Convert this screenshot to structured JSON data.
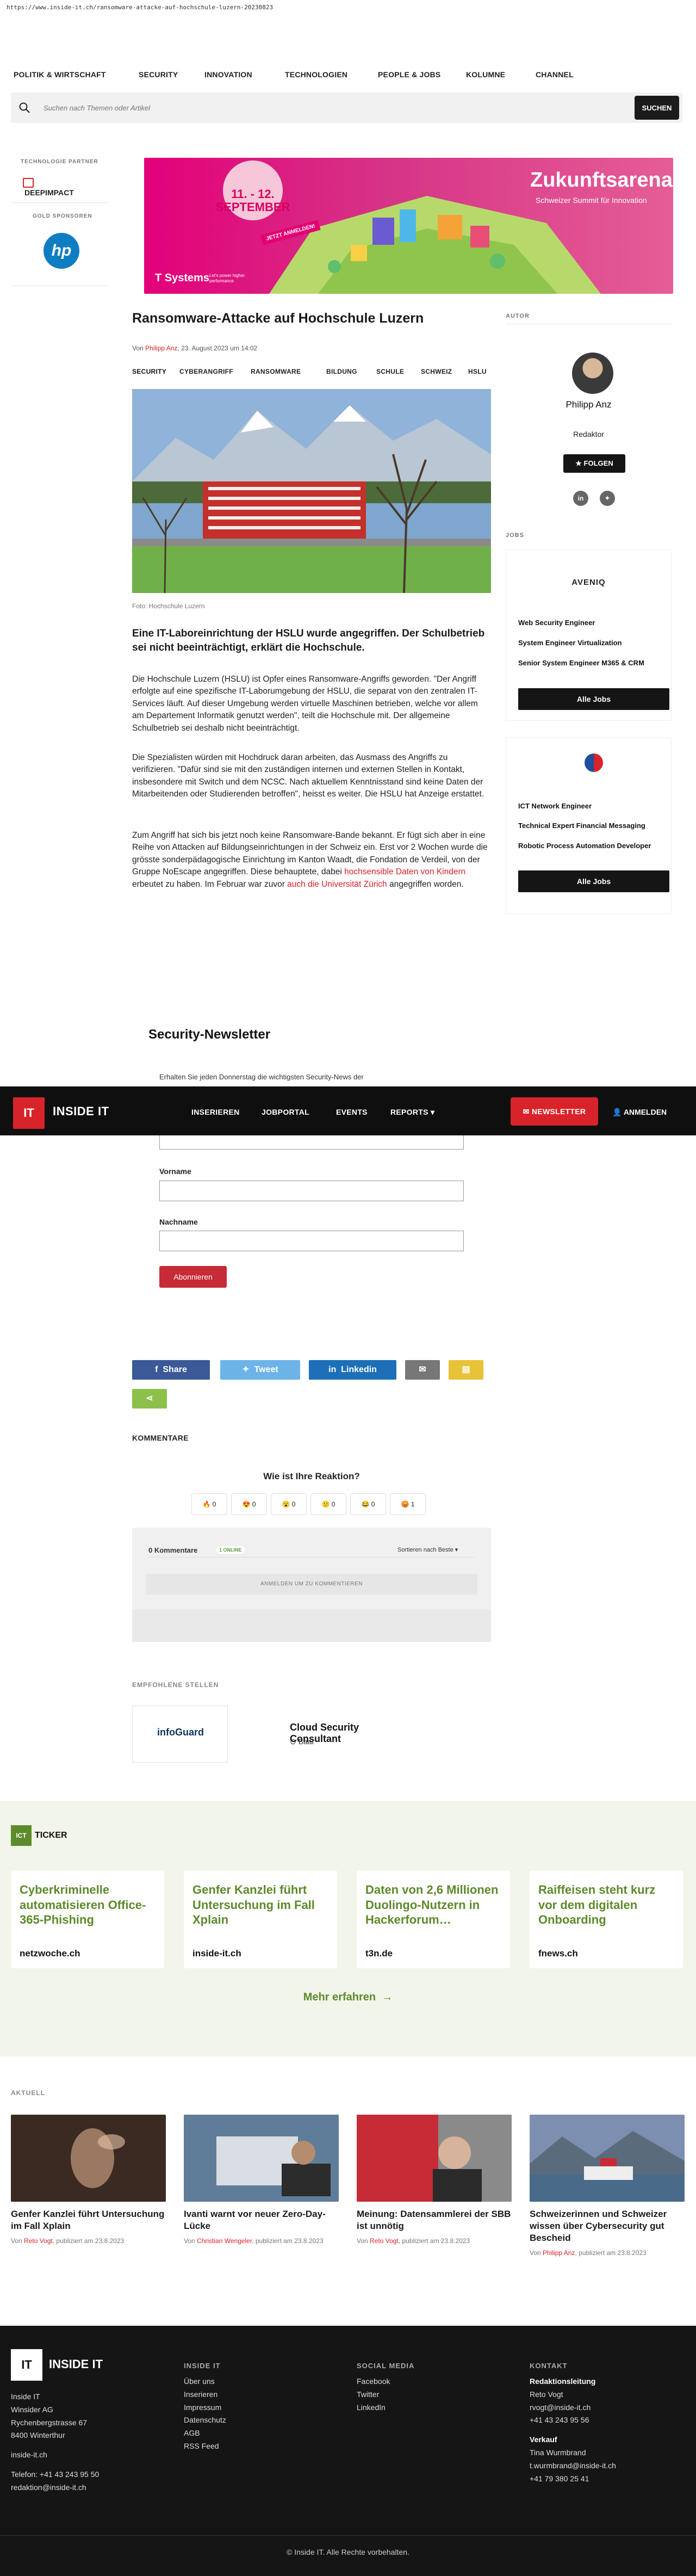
{
  "browser": {
    "url": "https://www.inside-it.ch/ransomware-attacke-auf-hochschule-luzern-20230823"
  },
  "top_nav": {
    "items": [
      "POLITIK & WIRTSCHAFT",
      "SECURITY",
      "INNOVATION",
      "TECHNOLOGIEN",
      "PEOPLE & JOBS",
      "KOLUMNE",
      "CHANNEL"
    ]
  },
  "search": {
    "placeholder": "Suchen nach Themen oder Artikel",
    "button": "SUCHEN"
  },
  "sidebar": {
    "partner_label": "TECHNOLOGIE PARTNER",
    "partner_name": "DEEPIMPACT",
    "gold_label": "GOLD SPONSOREN",
    "gold_name": "hp"
  },
  "banner": {
    "title": "Zukunftsarena",
    "subtitle": "Schweizer Summit für Innovation",
    "date": "11. - 12. SEPTEMBER",
    "cta": "JETZT ANMELDEN!",
    "sponsor": "T Systems",
    "sponsor_tag": "Let's power higher performance"
  },
  "article": {
    "title": "Ransomware-Attacke auf Hochschule Luzern",
    "by_prefix": "Von",
    "author": "Philipp Anz",
    "date": ", 23. August 2023 um 14:02",
    "tags": [
      "SECURITY",
      "CYBERANGRIFF",
      "RANSOMWARE",
      "BILDUNG",
      "SCHULE",
      "SCHWEIZ",
      "HSLU"
    ],
    "caption": "Foto: Hochschule Luzern",
    "lead": "Eine IT-Laboreinrichtung der HSLU wurde angegriffen. Der Schulbetrieb sei nicht beeinträchtigt, erklärt die Hochschule.",
    "p1": "Die Hochschule Luzern (HSLU) ist Opfer eines Ransomware-Angriffs geworden. \"Der Angriff erfolgte auf eine spezifische IT-Laborumgebung der HSLU, die separat von den zentralen IT-Services läuft. Auf dieser Umgebung werden virtuelle Maschinen betrieben, welche vor allem am Departement Informatik genutzt werden\", teilt die Hochschule mit. Der allgemeine Schulbetrieb sei deshalb nicht beeinträchtigt.",
    "p2": "Die Spezialisten würden mit Hochdruck daran arbeiten, das Ausmass des Angriffs zu verifizieren. \"Dafür sind sie mit den zuständigen internen und externen Stellen in Kontakt, insbesondere mit Switch und dem NCSC. Nach aktuellem Kenntnisstand sind keine Daten der Mitarbeitenden oder Studierenden betroffen\", heisst es weiter. Die HSLU hat Anzeige erstattet.",
    "p3_a": "Zum Angriff hat sich bis jetzt noch keine Ransomware-Bande bekannt. Er fügt sich aber in eine Reihe von Attacken auf Bildungseinrichtungen in der Schweiz ein. Erst vor 2 Wochen wurde die grösste sonderpädagogische Einrichtung im Kanton Waadt, die Fondation de Verdeil, von der Gruppe NoEscape angegriffen. Diese behauptete, dabei ",
    "p3_link1": "hochsensible Daten von Kindern",
    "p3_b": " erbeutet zu haben. Im Februar war zuvor ",
    "p3_link2": "auch die Universität Zürich",
    "p3_c": " angegriffen worden."
  },
  "author_box": {
    "label": "AUTOR",
    "name": "Philipp Anz",
    "role": "Redaktor",
    "follow": "FOLGEN"
  },
  "jobs": {
    "label": "JOBS",
    "company1": "AVENIQ",
    "list1": [
      "Web Security Engineer",
      "System Engineer Virtualization",
      "Senior System Engineer M365 & CRM"
    ],
    "list2": [
      "ICT Network Engineer",
      "Technical Expert Financial Messaging",
      "Robotic Process Automation Developer"
    ],
    "all_jobs": "Alle Jobs"
  },
  "newsletter": {
    "title": "Security-Newsletter",
    "text": "Erhalten Sie jeden Donnerstag die wichtigsten Security-News der",
    "first_name": "Vorname",
    "last_name": "Nachname",
    "button": "Abonnieren"
  },
  "dark_nav": {
    "logo": "IT",
    "brand": "INSIDE IT",
    "items": [
      "INSERIEREN",
      "JOBPORTAL",
      "EVENTS",
      "REPORTS"
    ],
    "newsletter": "NEWSLETTER",
    "login": "ANMELDEN"
  },
  "share": {
    "facebook": "Share",
    "twitter": "Tweet",
    "linkedin": "Linkedin"
  },
  "comments": {
    "heading": "KOMMENTARE",
    "reaction_title": "Wie ist Ihre Reaktion?",
    "reactions": [
      {
        "emoji": "🔥",
        "count": "0"
      },
      {
        "emoji": "😍",
        "count": "0"
      },
      {
        "emoji": "😮",
        "count": "0"
      },
      {
        "emoji": "😕",
        "count": "0"
      },
      {
        "emoji": "😂",
        "count": "0"
      },
      {
        "emoji": "😡",
        "count": "1"
      }
    ],
    "count_label": "0 Kommentare",
    "online": "1 ONLINE",
    "sort": "Sortieren nach Beste",
    "login_prompt": "ANMELDEN UM ZU KOMMENTIEREN"
  },
  "recommended": {
    "label": "EMPFOHLENE STELLEN",
    "company": "infoGuard",
    "job_title": "Cloud Security Consultant",
    "location": "Baar"
  },
  "ticker": {
    "logo": "ICT",
    "label": "TICKER",
    "cards": [
      {
        "title": "Cyberkriminelle automatisieren Office-365-Phishing",
        "source": "netzwoche.ch"
      },
      {
        "title": "Genfer Kanzlei führt Untersuchung im Fall Xplain",
        "source": "inside-it.ch"
      },
      {
        "title": "Daten von 2,6 Millionen Duolingo-Nutzern in Hackerforum…",
        "source": "t3n.de"
      },
      {
        "title": "Raiffeisen steht kurz vor dem digitalen Onboarding",
        "source": "fnews.ch"
      }
    ],
    "more": "Mehr erfahren"
  },
  "aktuell": {
    "label": "AKTUELL",
    "cards": [
      {
        "title": "Genfer Kanzlei führt Untersuchung im Fall Xplain",
        "by": "Von",
        "author": "Reto Vogt",
        "meta": ", publiziert am 23.8.2023"
      },
      {
        "title": "Ivanti warnt vor neuer Zero-Day-Lücke",
        "by": "Von",
        "author": "Christian Wengeler",
        "meta": ", publiziert am 23.8.2023"
      },
      {
        "title": "Meinung: Datensammlerei der SBB ist unnötig",
        "by": "Von",
        "author": "Reto Vogt",
        "meta": ", publiziert am 23.8.2023"
      },
      {
        "title": "Schweizerinnen und Schweizer wissen über Cybersecurity gut Bescheid",
        "by": "Von",
        "author": "Philipp Anz",
        "meta": ", publiziert am 23.8.2023"
      }
    ]
  },
  "footer": {
    "logo": "IT",
    "brand": "INSIDE IT",
    "address": [
      "Inside IT",
      "Winsider AG",
      "Rychenbergstrasse 67",
      "8400 Winterthur"
    ],
    "site": "inside-it.ch",
    "phone": "Telefon: +41 43 243 95 50",
    "email": "redaktion@inside-it.ch",
    "col2_head": "INSIDE IT",
    "col2": [
      "Über uns",
      "Inserieren",
      "Impressum",
      "Datenschutz",
      "AGB",
      "RSS Feed"
    ],
    "col3_head": "SOCIAL MEDIA",
    "col3": [
      "Facebook",
      "Twitter",
      "LinkedIn"
    ],
    "col4_head": "KONTAKT",
    "red_head": "Redaktionsleitung",
    "red": [
      "Reto Vogt",
      "rvogt@inside-it.ch",
      "+41 43 243 95 56"
    ],
    "verk_head": "Verkauf",
    "verk": [
      "Tina Wurmbrand",
      "t.wurmbrand@inside-it.ch",
      "+41 79 380 25 41"
    ],
    "copyright": "© Inside IT. Alle Rechte vorbehalten."
  },
  "colors": {
    "accent": "#d8232a",
    "ticker_green": "#5d8a2b",
    "dark": "#0f0f0f"
  }
}
